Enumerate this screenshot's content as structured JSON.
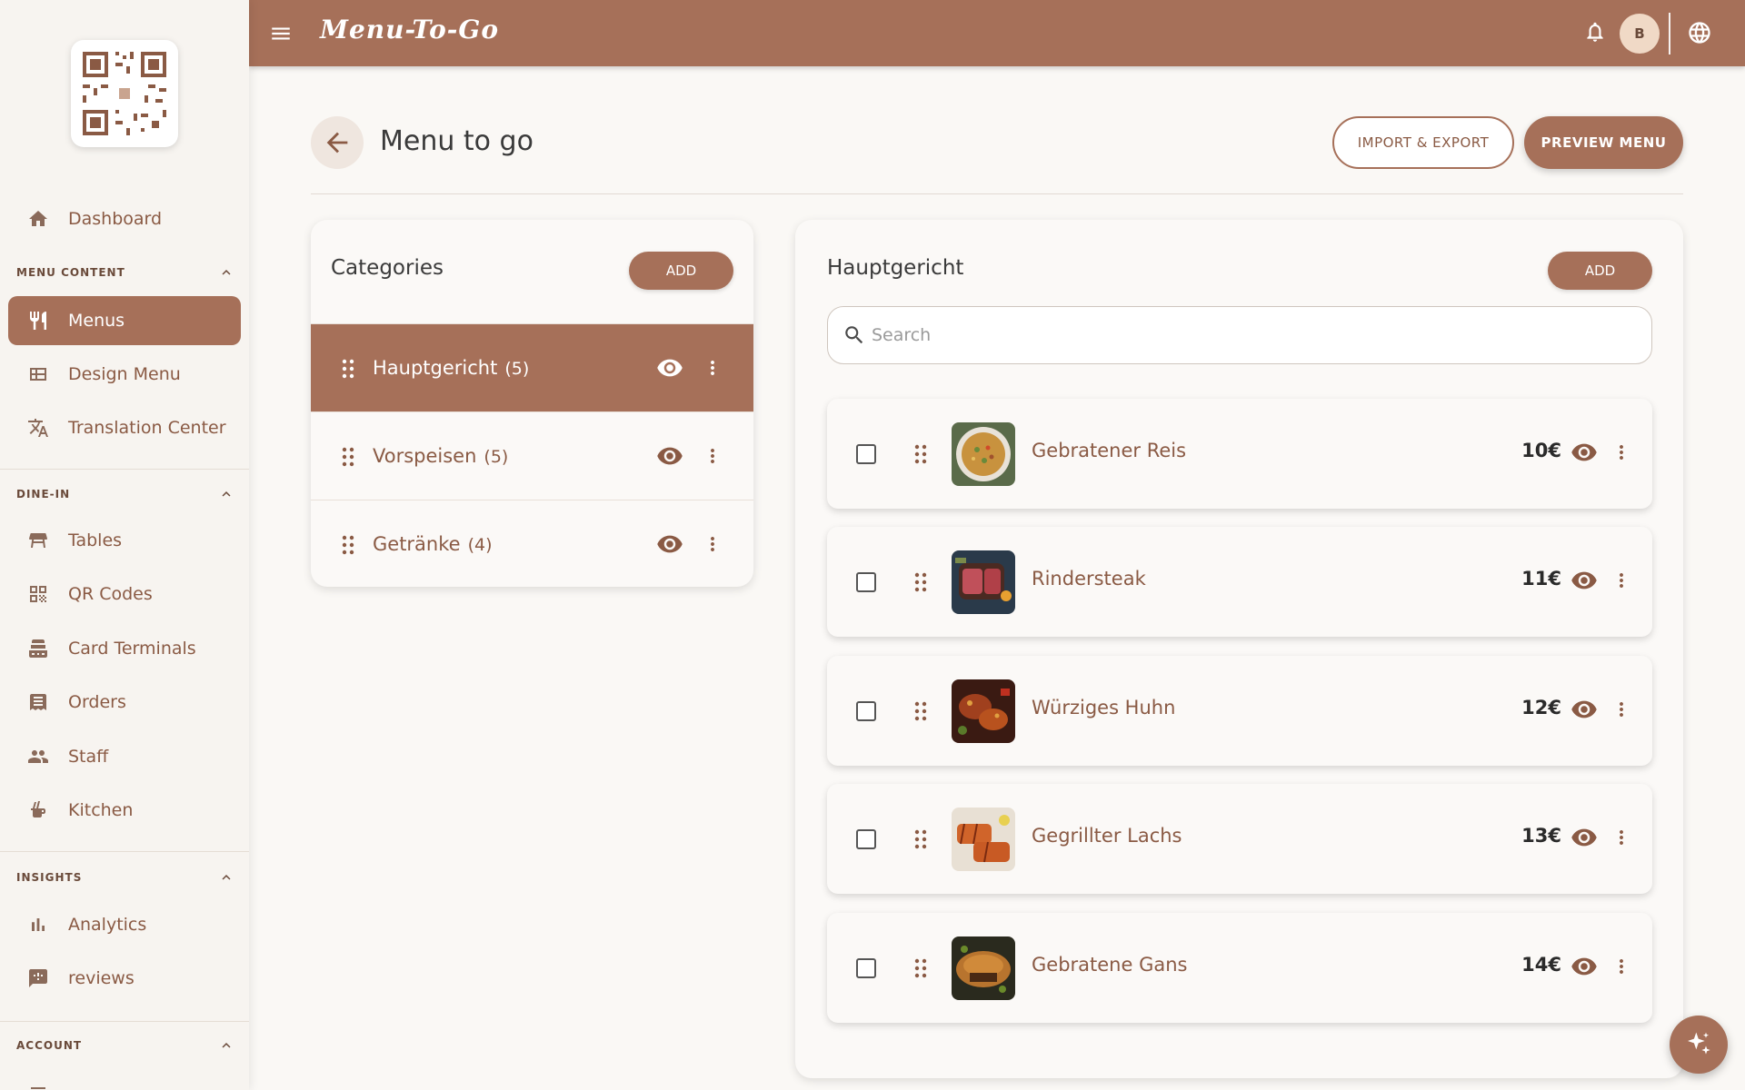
{
  "app": {
    "brand": "Menu-To-Go",
    "avatar_initial": "B"
  },
  "sidebar": {
    "dashboard": "Dashboard",
    "sections": {
      "menu_content": "MENU CONTENT",
      "dine_in": "DINE-IN",
      "insights": "INSIGHTS",
      "account": "ACCOUNT"
    },
    "items": {
      "menus": "Menus",
      "design_menu": "Design Menu",
      "translation_center": "Translation Center",
      "tables": "Tables",
      "qr_codes": "QR Codes",
      "card_terminals": "Card Terminals",
      "orders": "Orders",
      "staff": "Staff",
      "kitchen": "Kitchen",
      "analytics": "Analytics",
      "reviews": "reviews"
    }
  },
  "page": {
    "title": "Menu to go",
    "import_export": "IMPORT & EXPORT",
    "preview_menu": "PREVIEW MENU"
  },
  "categories": {
    "title": "Categories",
    "add_label": "ADD",
    "list": [
      {
        "name": "Hauptgericht",
        "count": "(5)",
        "active": true
      },
      {
        "name": "Vorspeisen",
        "count": "(5)",
        "active": false
      },
      {
        "name": "Getränke",
        "count": "(4)",
        "active": false
      }
    ]
  },
  "items": {
    "title": "Hauptgericht",
    "add_label": "ADD",
    "search_placeholder": "Search",
    "list": [
      {
        "name": "Gebratener Reis",
        "price": "10€"
      },
      {
        "name": "Rindersteak",
        "price": "11€"
      },
      {
        "name": "Würziges Huhn",
        "price": "12€"
      },
      {
        "name": "Gegrillter Lachs",
        "price": "13€"
      },
      {
        "name": "Gebratene Gans",
        "price": "14€"
      }
    ]
  },
  "colors": {
    "accent": "#a67059",
    "text_brown": "#8a5a44"
  }
}
